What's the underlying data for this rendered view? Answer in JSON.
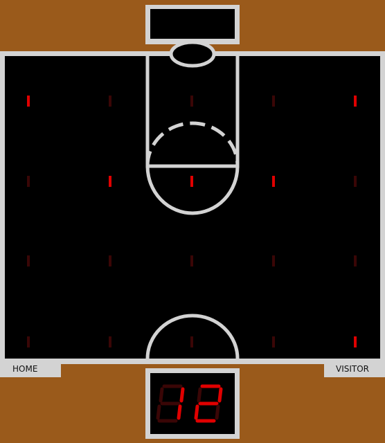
{
  "home_label": "HOME",
  "visitor_label": "VISITOR",
  "score_display": "12",
  "colors": {
    "wood": "#9a5a1b",
    "line": "#d3d3d3",
    "led_on": "#e00000",
    "led_dim": "#3a0606"
  },
  "led_grid": {
    "rows": 4,
    "cols": 5,
    "lit": [
      [
        true,
        false,
        false,
        false,
        true
      ],
      [
        false,
        true,
        true,
        true,
        false
      ],
      [
        false,
        false,
        false,
        false,
        false
      ],
      [
        false,
        false,
        false,
        false,
        true
      ]
    ]
  }
}
